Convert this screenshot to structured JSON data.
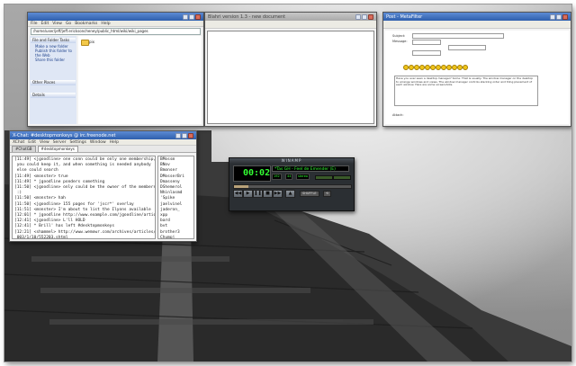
{
  "file_manager": {
    "title": "",
    "menu": [
      "File",
      "Edit",
      "View",
      "Go",
      "Bookmarks",
      "Help"
    ],
    "address": "/home/user/jeff/jeff.ericksoncheney/public_html/wiki/wiki_pages",
    "sidebar_sections": [
      "File and Folder Tasks",
      "Other Places",
      "Details"
    ],
    "sidebar_items": [
      "Make a new folder",
      "Publish this folder to the Web",
      "Share this folder"
    ],
    "folder_label": "pix"
  },
  "editor": {
    "title": "Blahri version 1.3 - new document"
  },
  "browser_form": {
    "title": "Post - MetaFilter",
    "subject_label": "Subject:",
    "message_label": "Message:",
    "attach_label": "Attach:",
    "text_preview": "Have you ever seen a desktop manager? Some. That is usually. The window manager on the desktop to arrange windows and views. The window manager controls stacking order and tiling placement of each window. Here are some screenshots."
  },
  "irc": {
    "title": "X-Chat: #desktopmonkeys @ irc.freenode.net",
    "menu": [
      "XChat",
      "Edit",
      "View",
      "Server",
      "Settings",
      "Window",
      "Help"
    ],
    "tabs": [
      "#ChatGB",
      "#desktopmonkeys"
    ],
    "log": [
      "[11:49] <jgoodline> one conn could be only one membership,",
      " you could keep it, and when something is needed anybody",
      " else could search",
      "[11:49] <monster> true",
      "[11:49] * jgoodline ponders something",
      "[11:50] <jgoodline> only could be the owner of the membership",
      " :)",
      "[11:50] <monster> hah",
      "[11:50] <jgoodline> 155 pages for 'jscr*' overlay",
      "[11:51] <monster> I'm about to list the Ilyons available",
      "[12:01] * jgoodline http://www.example.com/jgoodline/article",
      "[12:41] <jgoodline> L'll HOLD",
      "[12:41] * Brill' has left #desktopmonkeys",
      "[12:21] <shammel> http://www.wemowr.com/archives/articles/7",
      " 003/1/10/552203.shtml"
    ],
    "nicks": [
      "BMossm",
      "BNov",
      "Bmonser",
      "DMosserBri",
      "Dmasseny",
      "DShemerol",
      "Nhinlasmd",
      "'Spike",
      "jaelvinel",
      "jaderon_",
      "xpp",
      "bard",
      "bvt",
      "brother3",
      "Chumpj",
      "jasper"
    ]
  },
  "winamp": {
    "title": "WINAMP",
    "time": "00:02",
    "marquee": "*Tas GH - Feel de Emender (E)",
    "kbps": "192",
    "khz": "44",
    "mode": "stereo",
    "progress": 0.12,
    "buttons": [
      "◀◀",
      "▶",
      "❚❚",
      "■",
      "▶▶",
      "▲"
    ],
    "shuffle_label": "SHUFFLE",
    "repeat_label": "⟲"
  },
  "colors": {
    "titlebar_active": "#2e5fad",
    "winamp_lcd": "#33ff33"
  }
}
